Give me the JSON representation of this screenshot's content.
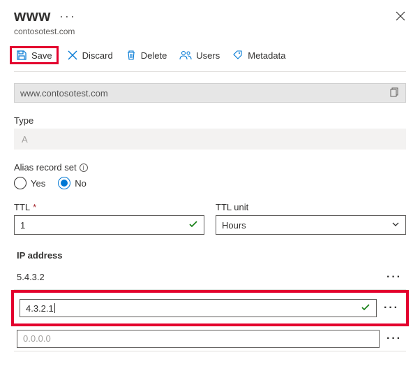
{
  "header": {
    "record_name": "www",
    "zone": "contosotest.com"
  },
  "toolbar": {
    "save_label": "Save",
    "discard_label": "Discard",
    "delete_label": "Delete",
    "users_label": "Users",
    "metadata_label": "Metadata"
  },
  "fqdn": {
    "value": "www.contosotest.com"
  },
  "type": {
    "label": "Type",
    "value": "A"
  },
  "alias": {
    "label": "Alias record set",
    "yes": "Yes",
    "no": "No",
    "selected": "No"
  },
  "ttl": {
    "label": "TTL",
    "value": "1",
    "unit_label": "TTL unit",
    "unit_value": "Hours"
  },
  "ip": {
    "label": "IP address",
    "rows": [
      {
        "value": "5.4.3.2",
        "editing": false
      },
      {
        "value": "4.3.2.1",
        "editing": true
      },
      {
        "value": "0.0.0.0",
        "editing": false,
        "placeholder": true
      }
    ]
  },
  "icons": {
    "more": "···",
    "row_more": "···"
  },
  "colors": {
    "highlight": "#e3002d",
    "accent": "#0078d4",
    "success": "#107c10"
  }
}
